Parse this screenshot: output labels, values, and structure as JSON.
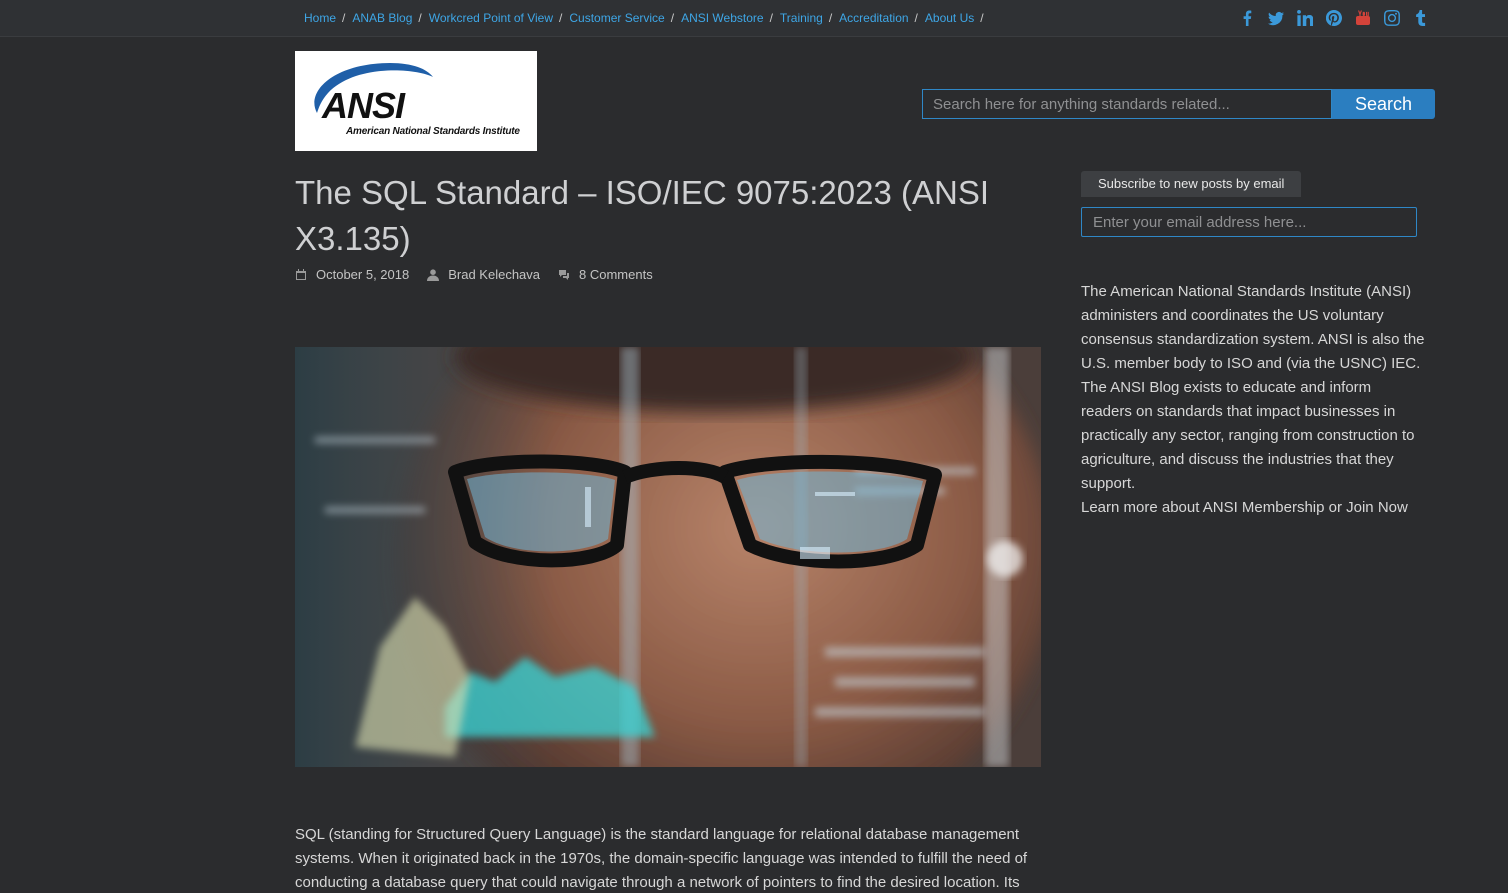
{
  "nav": {
    "items": [
      {
        "label": "Home"
      },
      {
        "label": "ANAB Blog"
      },
      {
        "label": "Workcred Point of View"
      },
      {
        "label": "Customer Service"
      },
      {
        "label": "ANSI Webstore"
      },
      {
        "label": "Training"
      },
      {
        "label": "Accreditation"
      },
      {
        "label": "About Us"
      }
    ],
    "separator": "/"
  },
  "social": [
    "facebook-icon",
    "twitter-icon",
    "linkedin-icon",
    "pinterest-icon",
    "youtube-icon",
    "instagram-icon",
    "tumblr-icon"
  ],
  "logo": {
    "word": "ANSI",
    "subtitle": "American National Standards Institute"
  },
  "search": {
    "placeholder": "Search here for anything standards related...",
    "button_label": "Search"
  },
  "article": {
    "title": "The SQL Standard – ISO/IEC 9075:2023 (ANSI X3.135)",
    "date": "October 5, 2018",
    "author": "Brad Kelechava",
    "comments": "8 Comments",
    "body": "SQL (standing for Structured Query Language) is the standard language for relational database management systems. When it originated back in the 1970s, the domain-specific language was intended to fulfill the need of conducting a database query that could navigate through a network of pointers to find the desired location. Its application in"
  },
  "sidebar": {
    "subscribe_label": "Subscribe to new posts by email",
    "email_placeholder": "Enter your email address here...",
    "about": "The American National Standards Institute (ANSI) administers and coordinates the US voluntary consensus standardization system. ANSI is also the U.S. member body to ISO and (via the USNC) IEC. The ANSI Blog exists to educate and inform readers on standards that impact businesses in practically any sector, ranging from construction to agriculture, and discuss the industries that they support.",
    "learn_more": "Learn more about ANSI Membership or Join Now"
  },
  "colors": {
    "background": "#2b2c2e",
    "link": "#3ea6e6",
    "accent": "#2b7ec0"
  }
}
